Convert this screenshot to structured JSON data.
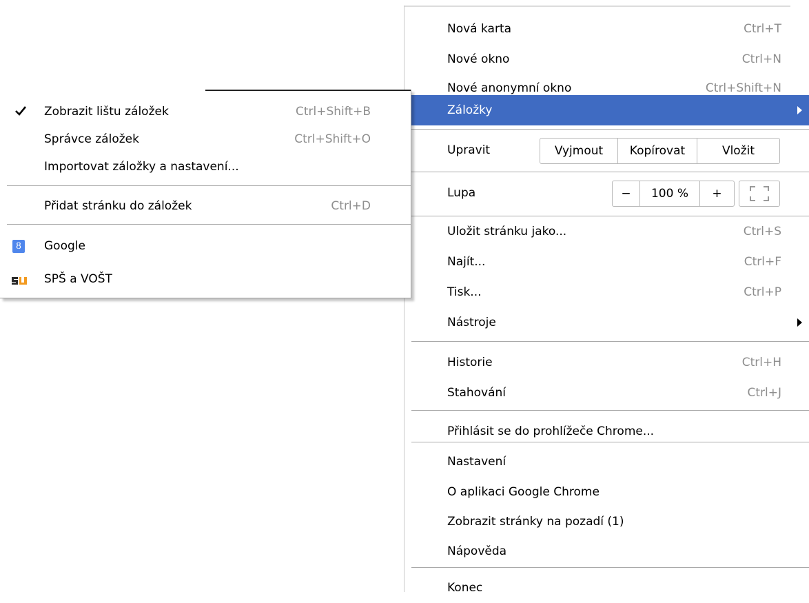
{
  "main_menu": {
    "items": [
      {
        "label": "Nová karta",
        "shortcut": "Ctrl+T"
      },
      {
        "label": "Nové okno",
        "shortcut": "Ctrl+N"
      },
      {
        "label": "Nové anonymní okno",
        "shortcut": "Ctrl+Shift+N"
      },
      {
        "label": "Záložky",
        "shortcut": ""
      }
    ],
    "edit": {
      "label": "Upravit",
      "cut": "Vyjmout",
      "copy": "Kopírovat",
      "paste": "Vložit"
    },
    "zoom": {
      "label": "Lupa",
      "minus": "−",
      "level": "100 %",
      "plus": "+"
    },
    "items2": [
      {
        "label": "Uložit stránku jako...",
        "shortcut": "Ctrl+S"
      },
      {
        "label": "Najít...",
        "shortcut": "Ctrl+F"
      },
      {
        "label": "Tisk...",
        "shortcut": "Ctrl+P"
      },
      {
        "label": "Nástroje",
        "shortcut": ""
      }
    ],
    "items3": [
      {
        "label": "Historie",
        "shortcut": "Ctrl+H"
      },
      {
        "label": "Stahování",
        "shortcut": "Ctrl+J"
      }
    ],
    "signin": "Přihlásit se do prohlížeče Chrome...",
    "items4": [
      {
        "label": "Nastavení"
      },
      {
        "label": "O aplikaci Google Chrome"
      },
      {
        "label": "Zobrazit stránky na pozadí (1)"
      },
      {
        "label": "Nápověda"
      }
    ],
    "exit": "Konec"
  },
  "bookmarks_submenu": {
    "items": [
      {
        "label": "Zobrazit lištu záložek",
        "shortcut": "Ctrl+Shift+B"
      },
      {
        "label": "Správce záložek",
        "shortcut": "Ctrl+Shift+O"
      },
      {
        "label": "Importovat záložky a nastavení...",
        "shortcut": ""
      }
    ],
    "add_page": {
      "label": "Přidat stránku do záložek",
      "shortcut": "Ctrl+D"
    },
    "bookmarks": [
      {
        "label": "Google",
        "icon": "google-favicon"
      },
      {
        "label": "SPŠ a VOŠT",
        "icon": "spsvost-favicon"
      }
    ]
  },
  "colors": {
    "highlight": "#3f6bc2",
    "shortcut_text": "#8e8e8e"
  }
}
